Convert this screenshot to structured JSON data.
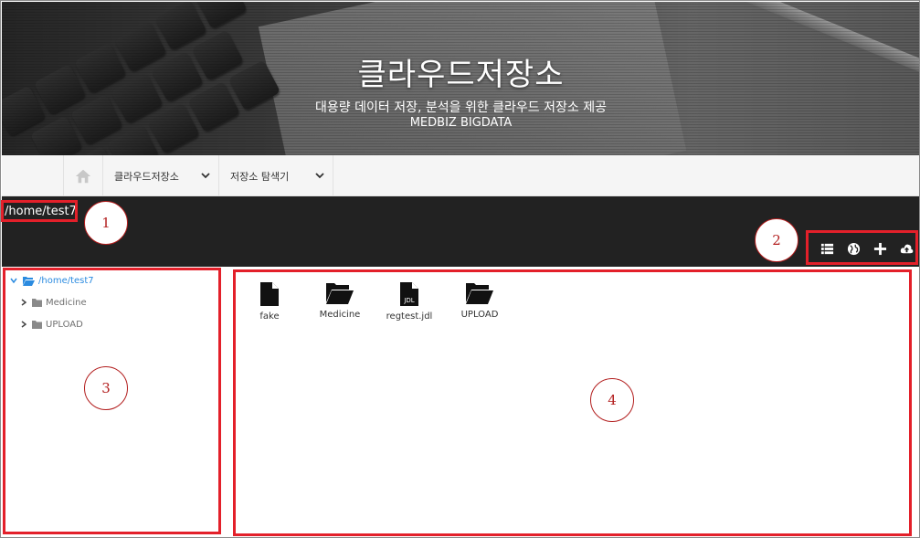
{
  "header": {
    "title": "클라우드저장소",
    "subtitle": "대용량 데이터 저장, 분석을 위한 클라우드 저장소 제공",
    "brand": "MEDBIZ BIGDATA"
  },
  "nav": {
    "home_icon": "home-icon",
    "items": [
      {
        "label": "클라우드저장소",
        "icon": "chevron-down-icon"
      },
      {
        "label": "저장소 탐색기",
        "icon": "chevron-down-icon"
      }
    ]
  },
  "toolbar": {
    "current_path": "/home/test7",
    "tools": [
      {
        "icon": "list-view-icon"
      },
      {
        "icon": "globe-icon"
      },
      {
        "icon": "plus-icon"
      },
      {
        "icon": "cloud-upload-icon"
      }
    ]
  },
  "tree": {
    "root": {
      "label": "/home/test7",
      "icon": "folder-open-icon"
    },
    "children": [
      {
        "label": "Medicine",
        "icon": "folder-icon"
      },
      {
        "label": "UPLOAD",
        "icon": "folder-icon"
      }
    ]
  },
  "files": [
    {
      "name": "fake",
      "icon": "file-icon"
    },
    {
      "name": "Medicine",
      "icon": "folder-open-icon"
    },
    {
      "name": "regtest.jdl",
      "icon": "jdl-file-icon",
      "badge": "JDL"
    },
    {
      "name": "UPLOAD",
      "icon": "folder-open-icon"
    }
  ],
  "annotations": [
    {
      "number": "1"
    },
    {
      "number": "2"
    },
    {
      "number": "3"
    },
    {
      "number": "4"
    }
  ],
  "colors": {
    "annotation_red": "#e3202a",
    "link_blue": "#2b8be0",
    "band_dark": "#222222"
  }
}
